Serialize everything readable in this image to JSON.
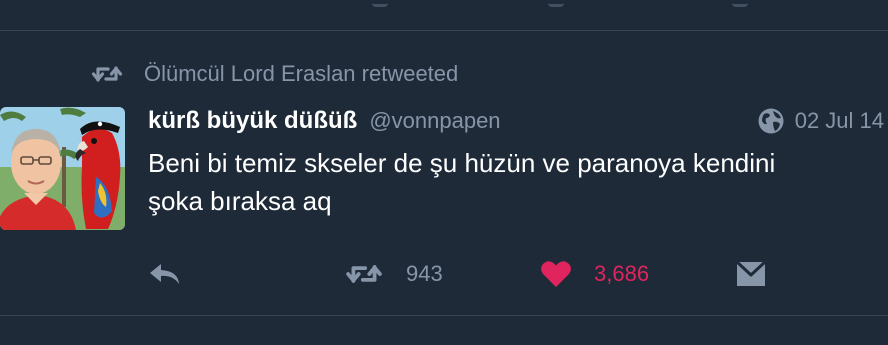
{
  "retweet_context": {
    "label": "Ölümcül Lord Eraslan retweeted",
    "icon": "retweet-icon"
  },
  "tweet": {
    "display_name": "kürß büyük düßüß",
    "handle": "@vonnpapen",
    "date": "02 Jul 14",
    "text_line1": "Beni bi temiz skseler de şu hüzün ve paranoya kendini",
    "text_line2": "şoka bıraksa aq",
    "avatar_icon": "avatar-man-with-parrot"
  },
  "actions": {
    "reply_icon": "reply-icon",
    "retweet_icon": "retweet-icon",
    "retweet_count": "943",
    "like_icon": "heart-icon",
    "like_count": "3,686",
    "dm_icon": "direct-message-icon"
  },
  "colors": {
    "background": "#1e2a38",
    "divider": "#37475a",
    "muted_text": "#8696a8",
    "like_red": "#e0245e",
    "text": "#ffffff"
  }
}
